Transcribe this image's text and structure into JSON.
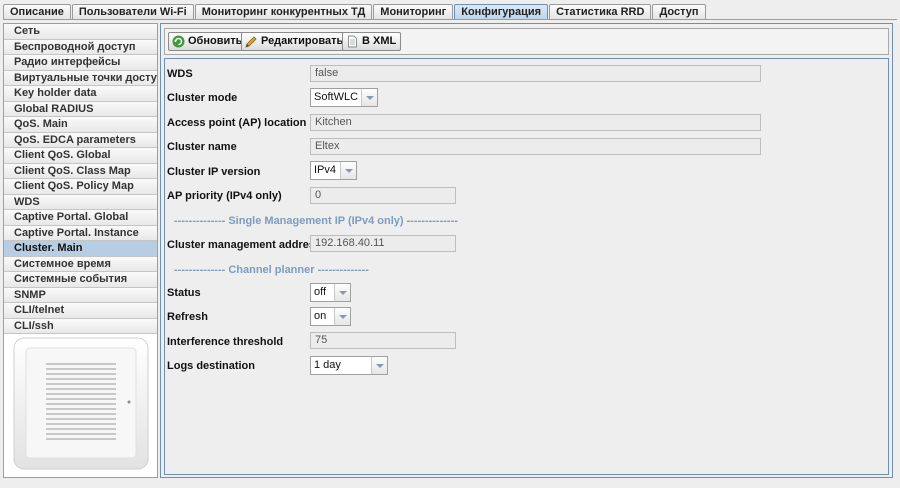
{
  "tabs": [
    {
      "label": "Описание",
      "active": false
    },
    {
      "label": "Пользователи Wi-Fi",
      "active": false
    },
    {
      "label": "Мониторинг конкурентных ТД",
      "active": false
    },
    {
      "label": "Мониторинг",
      "active": false
    },
    {
      "label": "Конфигурация",
      "active": true
    },
    {
      "label": "Статистика RRD",
      "active": false
    },
    {
      "label": "Доступ",
      "active": false
    }
  ],
  "sidebar": {
    "items": [
      {
        "label": "Сеть"
      },
      {
        "label": "Беспроводной доступ"
      },
      {
        "label": "Радио интерфейсы"
      },
      {
        "label": "Виртуальные точки доступа"
      },
      {
        "label": "Key holder data"
      },
      {
        "label": "Global RADIUS"
      },
      {
        "label": "QoS. Main"
      },
      {
        "label": "QoS. EDCA parameters"
      },
      {
        "label": "Client QoS. Global"
      },
      {
        "label": "Client QoS. Class Map"
      },
      {
        "label": "Client QoS. Policy Map"
      },
      {
        "label": "WDS"
      },
      {
        "label": "Captive Portal. Global"
      },
      {
        "label": "Captive Portal. Instance"
      },
      {
        "label": "Cluster. Main"
      },
      {
        "label": "Системное время"
      },
      {
        "label": "Системные события"
      },
      {
        "label": "SNMP"
      },
      {
        "label": "CLI/telnet"
      },
      {
        "label": "CLI/ssh"
      }
    ],
    "active_label": "Cluster. Main"
  },
  "toolbar": {
    "refresh_label": "Обновить",
    "edit_label": "Редактировать",
    "xml_label": "В XML"
  },
  "form": {
    "wds": {
      "label": "WDS",
      "value": "false"
    },
    "cluster_mode": {
      "label": "Cluster mode",
      "value": "SoftWLC"
    },
    "ap_location": {
      "label": "Access point (AP) location",
      "value": "Kitchen"
    },
    "cluster_name": {
      "label": "Cluster name",
      "value": "Eltex"
    },
    "cluster_ip_version": {
      "label": "Cluster IP version",
      "value": "IPv4"
    },
    "ap_priority": {
      "label": "AP priority (IPv4 only)",
      "value": "0"
    },
    "sep_smip": "-------------- Single Management IP (IPv4 only) --------------",
    "cluster_mgmt_address": {
      "label": "Cluster management address",
      "value": "192.168.40.11"
    },
    "sep_channel": "-------------- Channel planner --------------",
    "status": {
      "label": "Status",
      "value": "off"
    },
    "refresh": {
      "label": "Refresh",
      "value": "on"
    },
    "interference_threshold": {
      "label": "Interference threshold",
      "value": "75"
    },
    "logs_destination": {
      "label": "Logs destination",
      "value": "1 day"
    }
  },
  "colors": {
    "accent": "#b6cde3",
    "border_blue": "#6f8fb3",
    "separator_text": "#7d9cbf"
  }
}
